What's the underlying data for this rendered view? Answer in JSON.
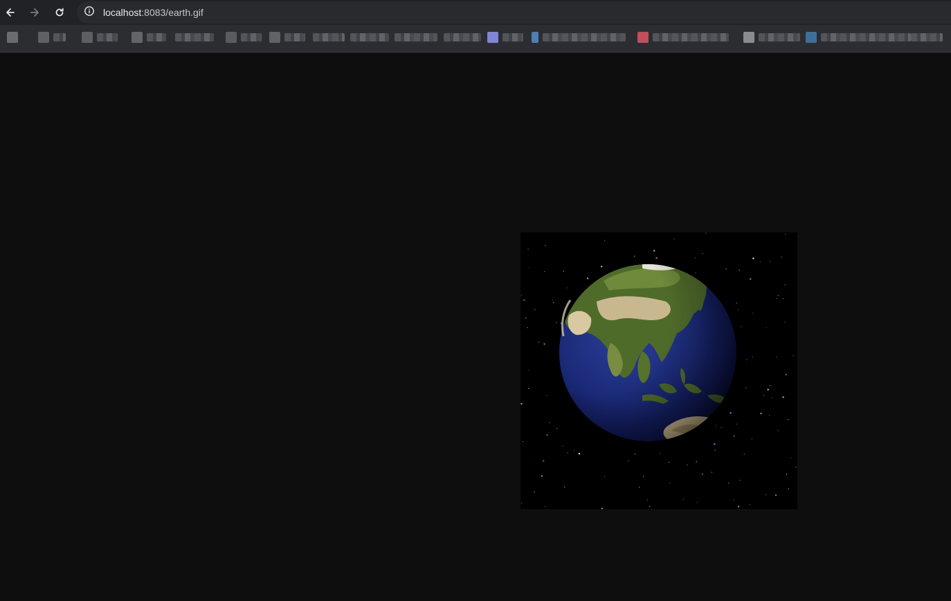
{
  "browser": {
    "url_host": "localhost",
    "url_path": ":8083/earth.gif",
    "icons": {
      "back": "arrow-left-icon",
      "forward": "arrow-right-icon",
      "reload": "reload-icon",
      "site_info": "info-circle-icon"
    },
    "bookmarks_blurred": true
  },
  "page": {
    "image_alt": "earth.gif",
    "image_kind": "animated-globe",
    "background_color": "#0e0e0e"
  }
}
